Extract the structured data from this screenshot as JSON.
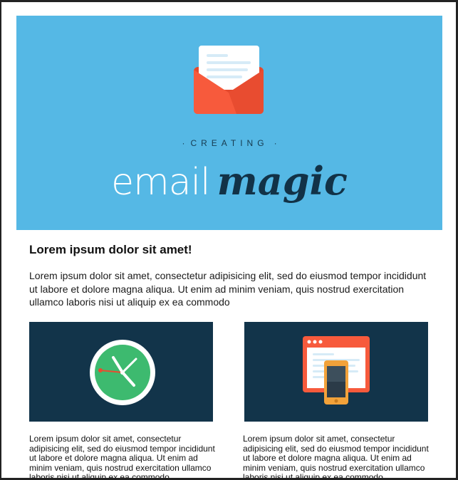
{
  "hero": {
    "kicker": "CREATING",
    "kicker_dot": "·",
    "title_light": "email",
    "title_bold": "magic",
    "colors": {
      "background": "#55b8e5",
      "envelope": "#f75a3c",
      "title_dark": "#123247"
    },
    "icon": "open-envelope-icon"
  },
  "content": {
    "heading": "Lorem ipsum dolor sit amet!",
    "intro": "Lorem ipsum dolor sit amet, consectetur adipisicing elit, sed do eiusmod tempor incididunt ut labore et dolore magna aliqua. Ut enim ad minim veniam, quis nostrud exercitation ullamco laboris nisi ut aliquip ex ea commodo"
  },
  "columns": [
    {
      "icon": "clock-icon",
      "text": "Lorem ipsum dolor sit amet, consectetur adipisicing elit, sed do eiusmod tempor incididunt ut labore et dolore magna aliqua. Ut enim ad minim veniam, quis nostrud exercitation ullamco laboris nisi ut aliquip ex ea commodo"
    },
    {
      "icon": "browser-phone-icon",
      "text": "Lorem ipsum dolor sit amet, consectetur adipisicing elit, sed do eiusmod tempor incididunt ut labore et dolore magna aliqua. Ut enim ad minim veniam, quis nostrud exercitation ullamco laboris nisi ut aliquip ex ea commodo"
    }
  ],
  "colors": {
    "card_background": "#12344a",
    "clock_green": "#3dba6f",
    "browser_red": "#f75a3c",
    "phone_orange": "#f2a23a"
  }
}
